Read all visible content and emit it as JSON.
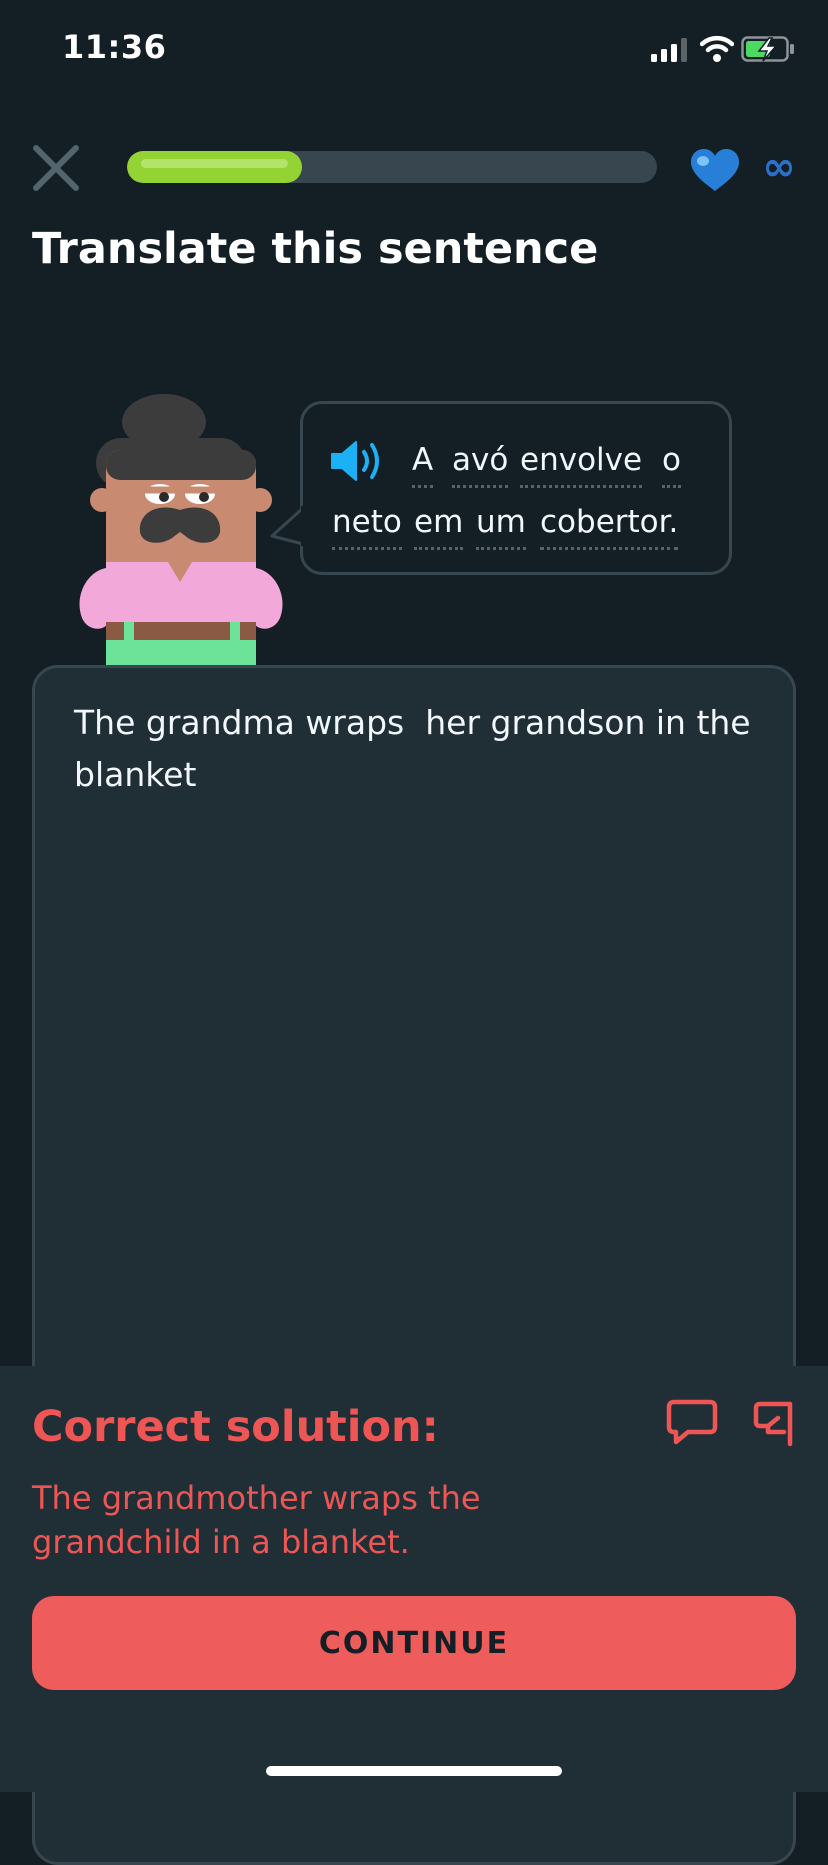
{
  "status_bar": {
    "time": "11:36",
    "icons": [
      "signal-icon",
      "wifi-icon",
      "battery-charging-icon"
    ]
  },
  "header": {
    "close_icon": "close-icon",
    "progress_fraction": 0.33,
    "hearts_icon": "heart-icon",
    "hearts_value": "∞"
  },
  "prompt": {
    "title": "Translate this sentence",
    "speaker_icon": "speaker-icon",
    "sentence_tokens": [
      "A",
      "avó",
      "envolve",
      "o",
      "neto",
      "em",
      "um",
      "cobertor."
    ]
  },
  "answer": {
    "text": "The grandma wraps  her grandson in the blanket"
  },
  "result": {
    "title": "Correct solution:",
    "solution": "The grandmother wraps the grandchild in a blanket.",
    "discuss_icon": "comment-icon",
    "report_icon": "flag-icon",
    "continue_label": "CONTINUE"
  },
  "colors": {
    "background": "#131f24",
    "panel": "#202f36",
    "border": "#37464f",
    "progress": "#93d333",
    "error": "#ee5555",
    "heart": "#1cb0f6"
  }
}
